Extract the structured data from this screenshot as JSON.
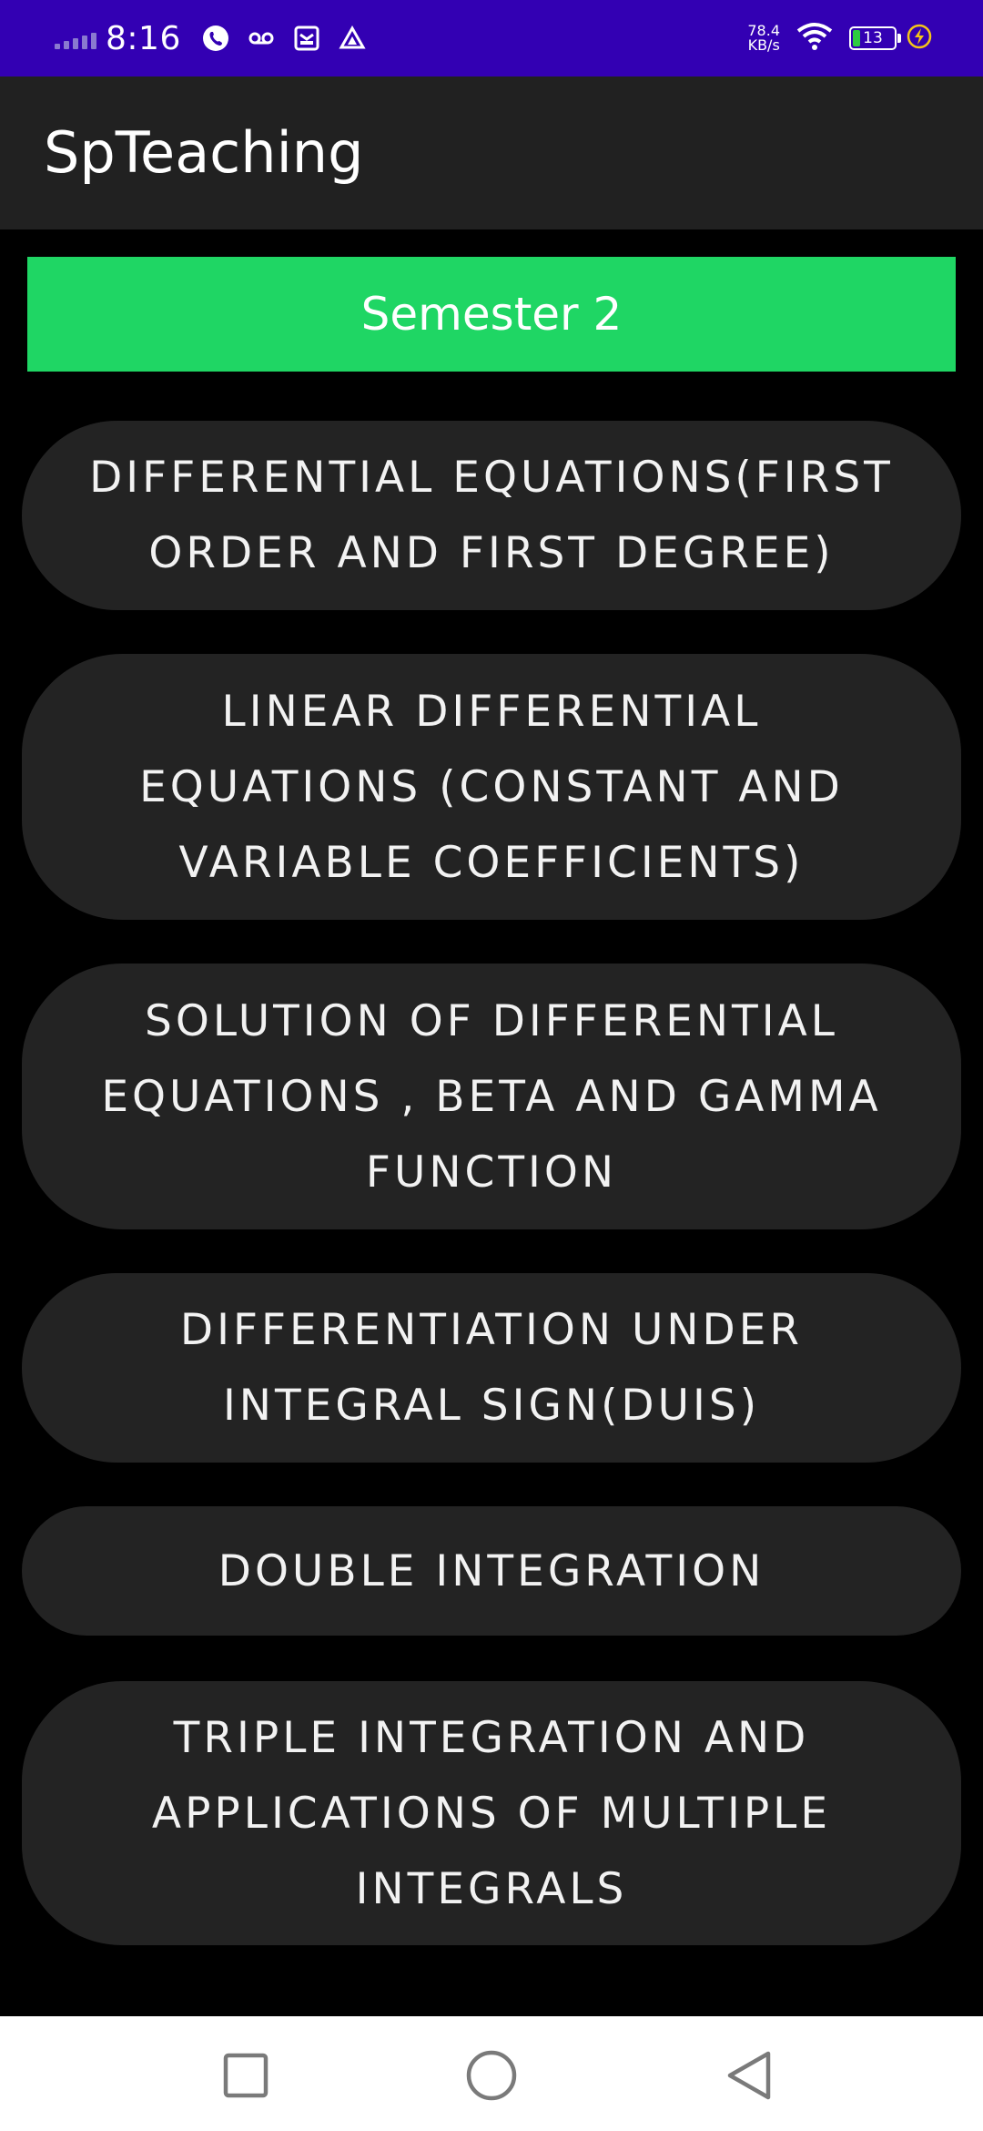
{
  "status_bar": {
    "time": "8:16",
    "net_speed_value": "78.4",
    "net_speed_unit": "KB/s",
    "battery_level": "13"
  },
  "app_bar": {
    "title": "SpTeaching"
  },
  "semester": {
    "label": "Semester 2"
  },
  "topics": [
    "DIFFERENTIAL EQUATIONS(FIRST ORDER AND FIRST DEGREE)",
    "LINEAR DIFFERENTIAL EQUATIONS (CONSTANT AND VARIABLE COEFFICIENTS)",
    "SOLUTION OF DIFFERENTIAL EQUATIONS , BETA AND GAMMA FUNCTION",
    "DIFFERENTIATION UNDER INTEGRAL SIGN(DUIS)",
    "DOUBLE INTEGRATION",
    "TRIPLE INTEGRATION AND APPLICATIONS OF MULTIPLE INTEGRALS"
  ],
  "nav_bar": {
    "recents": "square-icon",
    "home": "circle-icon",
    "back": "triangle-back-icon"
  },
  "colors": {
    "status_bar": "#3300b3",
    "app_bar": "#212121",
    "background": "#000000",
    "semester_banner": "#1fd664",
    "topic_button": "#232323"
  }
}
